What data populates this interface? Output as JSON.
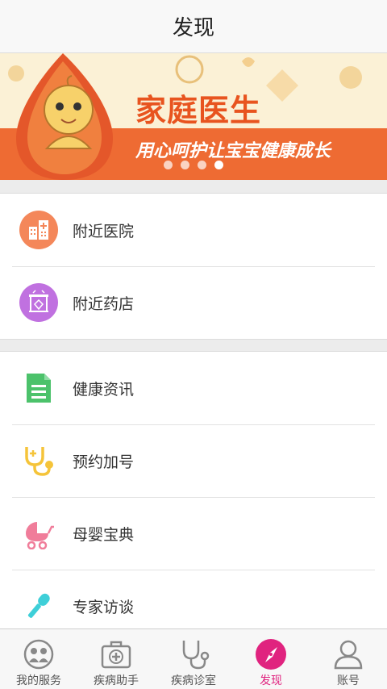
{
  "header": {
    "title": "发现"
  },
  "banner": {
    "headline": "家庭医生",
    "slogan": "用心呵护让宝宝健康成长",
    "slide_count": 4,
    "active_slide": 4
  },
  "groups": [
    {
      "items": [
        {
          "label": "附近医院",
          "icon": "hospital-icon",
          "color": "#f4875a"
        },
        {
          "label": "附近药店",
          "icon": "pharmacy-icon",
          "color": "#c071e0"
        }
      ]
    },
    {
      "items": [
        {
          "label": "健康资讯",
          "icon": "document-icon",
          "color": "#4cc26b"
        },
        {
          "label": "预约加号",
          "icon": "stethoscope-icon",
          "color": "#f5c43a"
        },
        {
          "label": "母婴宝典",
          "icon": "baby-stroller-icon",
          "color": "#f07d9a"
        },
        {
          "label": "专家访谈",
          "icon": "microphone-icon",
          "color": "#3ecfd8"
        }
      ]
    }
  ],
  "tabbar": {
    "tabs": [
      {
        "label": "我的服务",
        "icon": "service-icon"
      },
      {
        "label": "疾病助手",
        "icon": "medical-kit-icon"
      },
      {
        "label": "疾病诊室",
        "icon": "stethoscope-icon"
      },
      {
        "label": "发现",
        "icon": "compass-icon",
        "active": true
      },
      {
        "label": "账号",
        "icon": "user-icon"
      }
    ],
    "active_color": "#e0237f"
  }
}
